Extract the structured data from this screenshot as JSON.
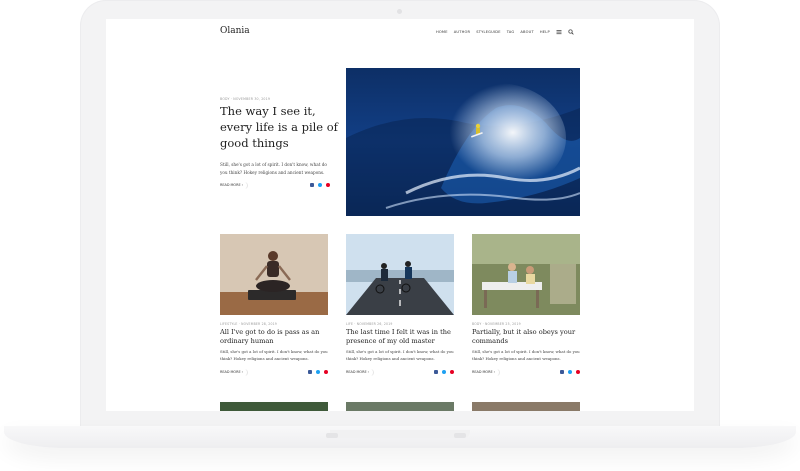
{
  "site": {
    "title": "Olania"
  },
  "nav": {
    "items": [
      {
        "label": "HOME"
      },
      {
        "label": "AUTHOR"
      },
      {
        "label": "STYLEGUIDE"
      },
      {
        "label": "TAG"
      },
      {
        "label": "ABOUT"
      },
      {
        "label": "HELP"
      }
    ],
    "menu_icon": "hamburger-menu-icon",
    "search_icon": "search-icon"
  },
  "featured": {
    "meta": "BODY · NOVEMBER 30, 2019",
    "title": "The way I see it, every life is a pile of good things",
    "excerpt": "Still, she's got a lot of spirit. I don't know, what do you think? Hokey religions and ancient weapons.",
    "read_more": "READ MORE ›",
    "image": "surfer-on-wave"
  },
  "cards": [
    {
      "meta": "LIFESTYLE · NOVEMBER 28, 2019",
      "title": "All I've got to do is pass as an ordinary human",
      "excerpt": "Still, she's got a lot of spirit. I don't know, what do you think? Hokey religions and ancient weapons.",
      "read_more": "READ MORE ›",
      "image": "woman-yoga-meditation"
    },
    {
      "meta": "LIFE · NOVEMBER 26, 2019",
      "title": "The last time I felt it was in the presence of my old master",
      "excerpt": "Still, she's got a lot of spirit. I don't know, what do you think? Hokey religions and ancient weapons.",
      "read_more": "READ MORE ›",
      "image": "two-cyclists-on-road"
    },
    {
      "meta": "BODY · NOVEMBER 25, 2019",
      "title": "Partially, but it also obeys your commands",
      "excerpt": "Still, she's got a lot of spirit. I don't know, what do you think? Hokey religions and ancient weapons.",
      "read_more": "READ MORE ›",
      "image": "friends-dining-outdoors"
    }
  ],
  "share_icons": [
    "facebook-icon",
    "twitter-icon",
    "pinterest-icon"
  ],
  "colors": {
    "facebook": "#3b5998",
    "twitter": "#1da1f2",
    "pinterest": "#e60023",
    "frame": "#f3f3f4"
  }
}
